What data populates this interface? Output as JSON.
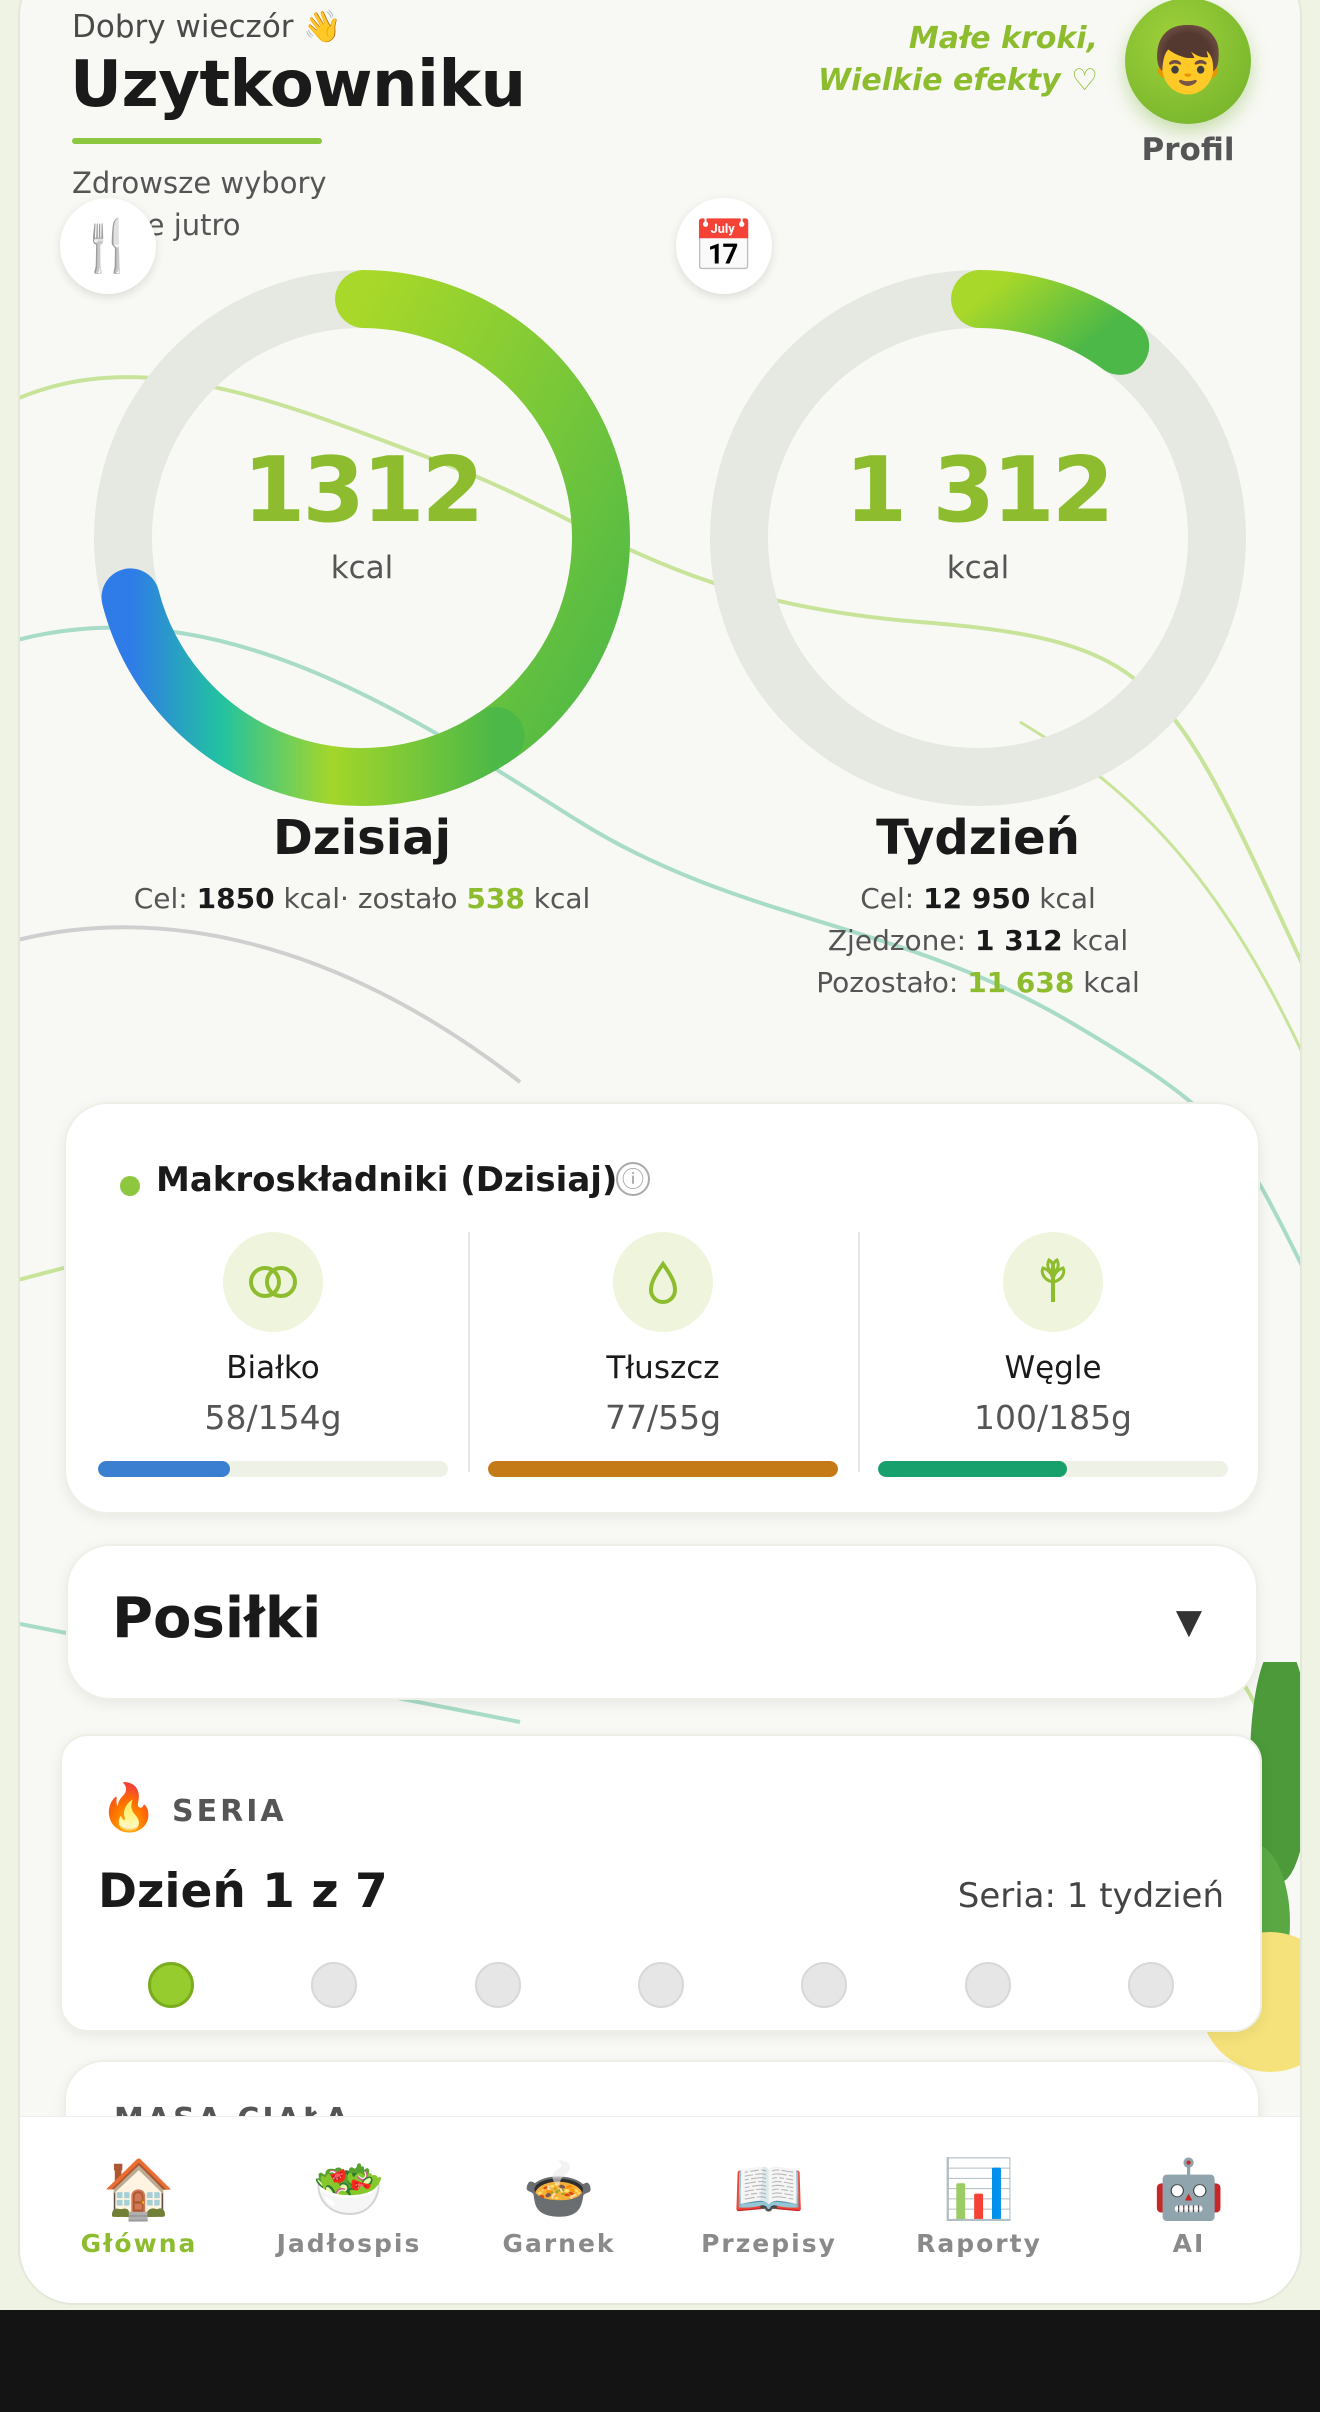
{
  "header": {
    "greeting": "Dobry wieczór 👋",
    "username": "Uzytkowniku",
    "tagline_line1": "Zdrowsze wybory",
    "tagline_line2": "lepsze jutro",
    "motto_line1": "Małe kroki,",
    "motto_line2": "Wielkie efekty ♡",
    "profile_avatar": "👦",
    "profile_label": "Profil"
  },
  "today": {
    "icon": "🍴",
    "value": "1312",
    "unit": "kcal",
    "title": "Dzisiaj",
    "goal_label": "Cel:",
    "goal_value": "1850",
    "goal_unit": "kcal",
    "remaining_label": "· zostało",
    "remaining_value": "538",
    "remaining_unit": "kcal",
    "progress_fraction": 0.71
  },
  "week": {
    "icon": "📅",
    "value": "1 312",
    "unit": "kcal",
    "title": "Tydzień",
    "goal_label": "Cel:",
    "goal_value": "12 950",
    "goal_unit": "kcal",
    "eaten_label": "Zjedzone:",
    "eaten_value": "1 312",
    "eaten_unit": "kcal",
    "left_label": "Pozostało:",
    "left_value": "11 638",
    "left_unit": "kcal",
    "progress_fraction": 0.1
  },
  "macros": {
    "title": "Makroskładniki (Dzisiaj)",
    "info_icon": "ⓘ",
    "items": [
      {
        "name": "Białko",
        "value": "58/154g",
        "fraction": 0.377,
        "color": "#3b7fd0",
        "icon": "rings-icon"
      },
      {
        "name": "Tłuszcz",
        "value": "77/55g",
        "fraction": 1.0,
        "color": "#c47a16",
        "icon": "drop-icon"
      },
      {
        "name": "Węgle",
        "value": "100/185g",
        "fraction": 0.54,
        "color": "#17a06c",
        "icon": "sprout-icon"
      }
    ]
  },
  "meals": {
    "title": "Posiłki",
    "toggle": "▼"
  },
  "streak": {
    "icon": "🔥",
    "label": "SERIA",
    "day_text": "Dzień 1 z 7",
    "week_text": "Seria: 1 tydzień",
    "days_total": 7,
    "days_done": 1
  },
  "weight": {
    "label": "MASA CIAŁA"
  },
  "nav": {
    "items": [
      {
        "label": "Główna",
        "icon": "🏠",
        "active": true
      },
      {
        "label": "Jadłospis",
        "icon": "🥗",
        "active": false
      },
      {
        "label": "Garnek",
        "icon": "🍲",
        "active": false
      },
      {
        "label": "Przepisy",
        "icon": "📖",
        "active": false
      },
      {
        "label": "Raporty",
        "icon": "📊",
        "active": false
      },
      {
        "label": "AI",
        "icon": "🤖",
        "active": false
      }
    ]
  },
  "colors": {
    "accent": "#8dbd2f",
    "ring_track": "#e6e8e2",
    "ring_green": "#58b947",
    "ring_blue": "#2f7be8"
  }
}
